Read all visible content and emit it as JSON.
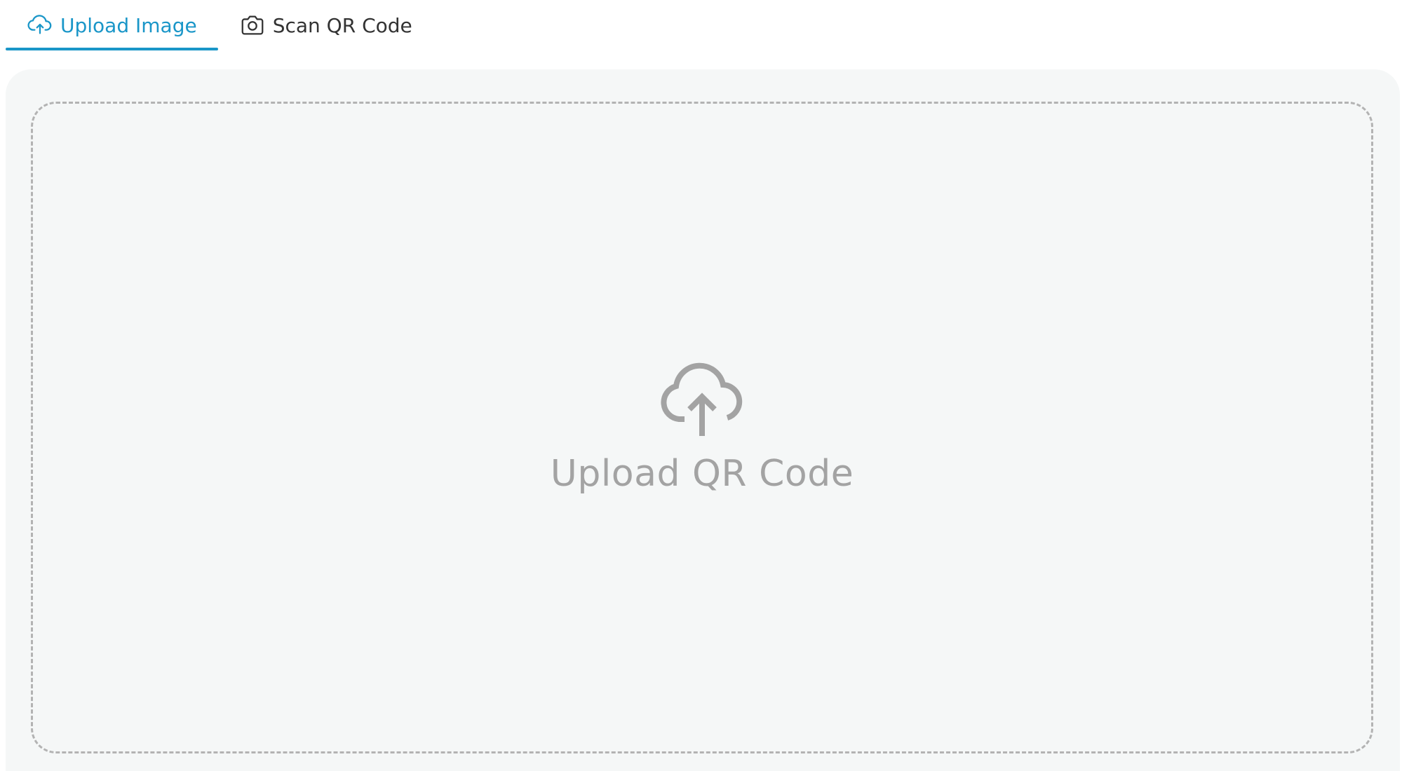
{
  "tabs": [
    {
      "label": "Upload Image",
      "icon": "cloud-upload-icon",
      "active": true
    },
    {
      "label": "Scan QR Code",
      "icon": "camera-icon",
      "active": false
    }
  ],
  "dropzone": {
    "label": "Upload QR Code",
    "icon": "cloud-upload-icon"
  },
  "colors": {
    "accent": "#1a96c8",
    "panel_bg": "#f5f7f7",
    "muted_text": "#a3a3a3",
    "dashed_border": "#b3b3b3"
  }
}
